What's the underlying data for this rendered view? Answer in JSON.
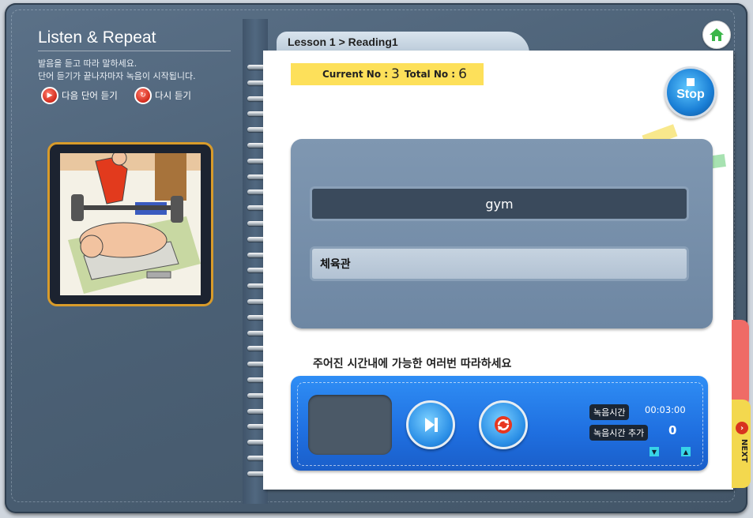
{
  "left_panel": {
    "title": "Listen & Repeat",
    "instruction_line1": "발음을 듣고 따라 말하세요.",
    "instruction_line2": "단어 듣기가 끝나자마자 녹음이 시작됩니다.",
    "next_word_label": "다음 단어 듣기",
    "replay_label": "다시 듣기"
  },
  "header": {
    "breadcrumb": "Lesson 1 > Reading1"
  },
  "counter": {
    "current_label": "Current No :",
    "current_value": "3",
    "total_label": "Total No :",
    "total_value": "6"
  },
  "stop_button": {
    "label": "Stop"
  },
  "word_card": {
    "word": "gym",
    "meaning": "체육관"
  },
  "instruction": "주어진 시간내에 가능한 여러번 따라하세요",
  "recorder": {
    "record_time_label": "녹음시간",
    "record_time_value": "00:03:00",
    "add_time_label": "녹음시간 추가",
    "add_time_value": "0"
  },
  "next_tab": {
    "label": "NEXT"
  },
  "icons": {
    "home": "home-icon",
    "stop": "stop-icon",
    "play_next": "play-next-icon",
    "replay": "replay-icon",
    "down": "arrow-down-icon",
    "up": "arrow-up-icon",
    "next": "chevron-right-icon"
  },
  "colors": {
    "accent_blue": "#2a8ee6",
    "panel": "#4b6075",
    "highlight_yellow": "#fde05a",
    "frame_gold": "#d89b2a",
    "next_tab": "#f3d84e"
  }
}
